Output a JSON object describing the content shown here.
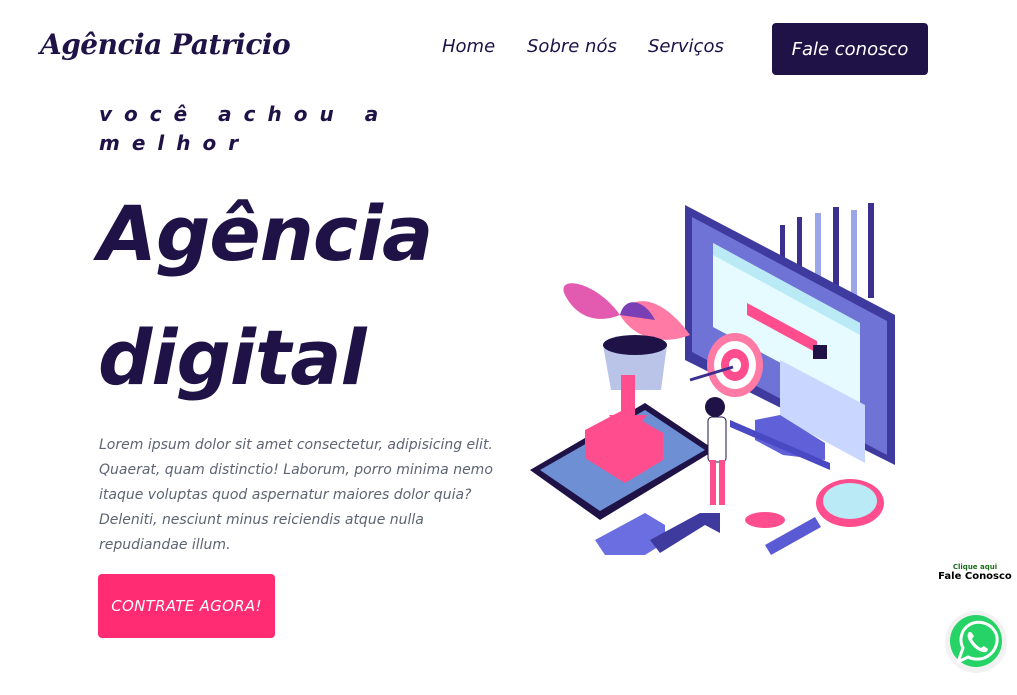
{
  "header": {
    "logo": "Agência Patricio",
    "nav": [
      "Home",
      "Sobre nós",
      "Serviços"
    ],
    "cta": "Fale conosco"
  },
  "hero": {
    "eyebrow": "você achou a melhor",
    "headline_line1": "Agência",
    "headline_line2": "digital",
    "paragraph": "Lorem ipsum dolor sit amet consectetur, adipisicing elit. Quaerat, quam distinctio! Laborum, porro minima nemo itaque voluptas quod aspernatur maiores dolor quia? Deleniti, nesciunt minus reiciendis atque nulla repudiandae illum.",
    "cta": "CONTRATE AGORA!"
  },
  "whatsapp": {
    "sub": "Clique aqui",
    "main": "Fale Conosco",
    "icon": "whatsapp-icon"
  },
  "colors": {
    "primary": "#1e1247",
    "accent": "#ff2b73",
    "whatsapp": "#25d366"
  }
}
